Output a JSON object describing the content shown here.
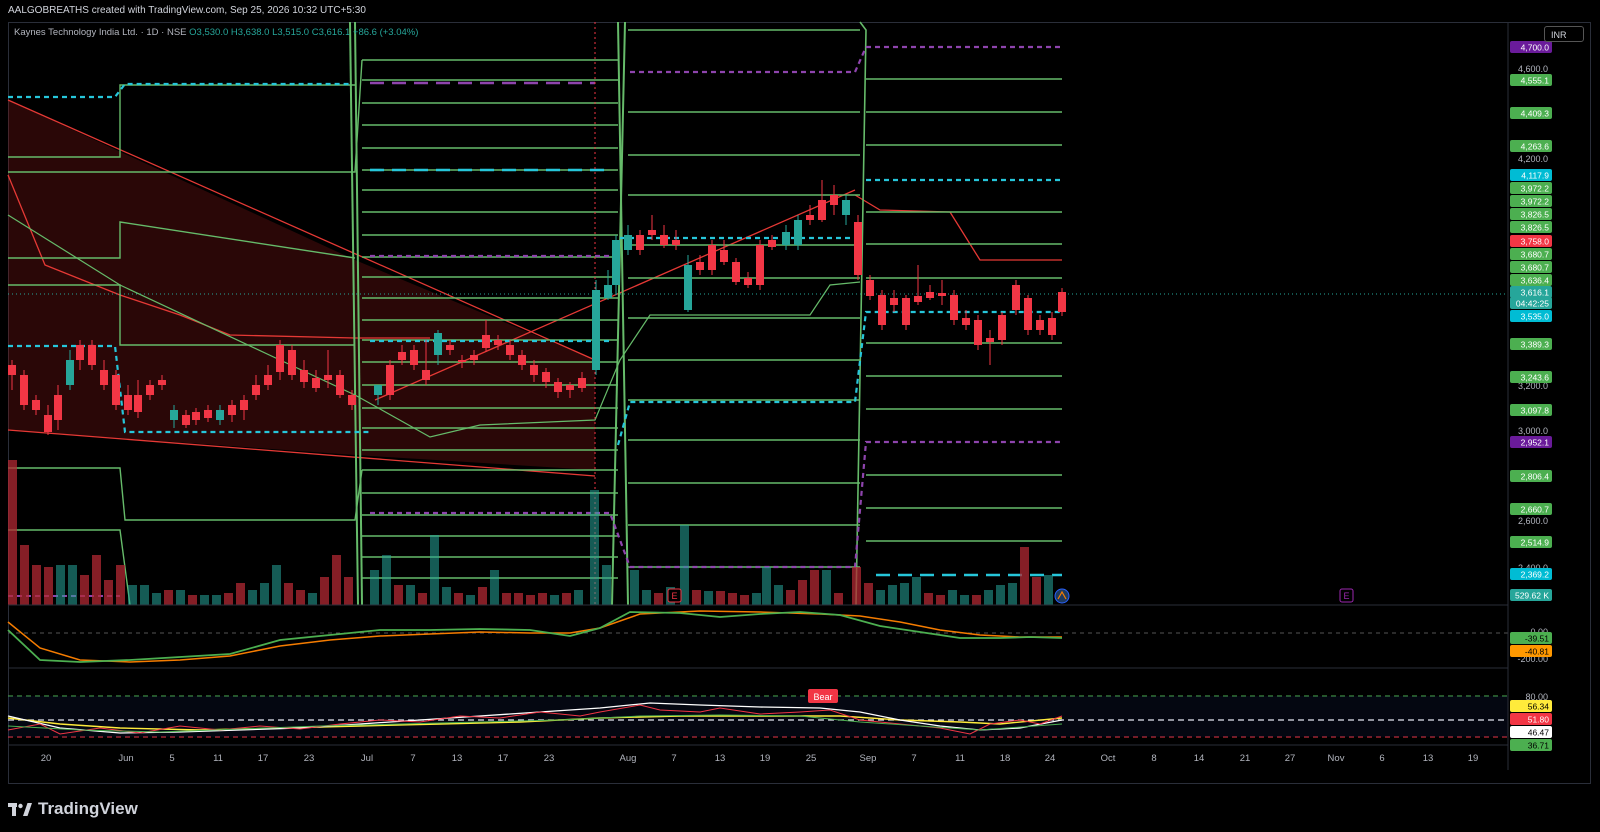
{
  "header": {
    "author_line": "AALGOBREATHS created with TradingView.com, Sep 25, 2026 10:32 UTC+5:30"
  },
  "symbol": {
    "name": "Kaynes Technology India Ltd. · 1D · NSE",
    "open": "O3,530.0",
    "high": "H3,638.0",
    "low": "L3,515.0",
    "close": "C3,616.1",
    "change": "+86.6 (+3.04%)"
  },
  "currency": "INR",
  "price_scale": {
    "ticks": [
      "4,600.0",
      "4,200.0",
      "3,200.0",
      "3,000.0",
      "2,600.0",
      "2,400.0"
    ],
    "labels": [
      {
        "text": "4,700.0",
        "color": "#6a1b9a"
      },
      {
        "text": "4,555.1",
        "color": "#4caf50"
      },
      {
        "text": "4,409.3",
        "color": "#4caf50"
      },
      {
        "text": "4,263.6",
        "color": "#4caf50"
      },
      {
        "text": "4,117.9",
        "color": "#00bcd4"
      },
      {
        "text": "3,972.2",
        "color": "#4caf50"
      },
      {
        "text": "3,972.2",
        "color": "#4caf50"
      },
      {
        "text": "3,826.5",
        "color": "#4caf50"
      },
      {
        "text": "3,826.5",
        "color": "#4caf50"
      },
      {
        "text": "3,758.0",
        "color": "#f23645"
      },
      {
        "text": "3,680.7",
        "color": "#4caf50"
      },
      {
        "text": "3,680.7",
        "color": "#4caf50"
      },
      {
        "text": "3,636.4",
        "color": "#4caf50"
      },
      {
        "text": "3,616.1",
        "color": "#26a69a"
      },
      {
        "text": "04:42:25",
        "color": "#26a69a"
      },
      {
        "text": "3,535.0",
        "color": "#00bcd4"
      },
      {
        "text": "3,389.3",
        "color": "#4caf50"
      },
      {
        "text": "3,243.6",
        "color": "#4caf50"
      },
      {
        "text": "3,097.8",
        "color": "#4caf50"
      },
      {
        "text": "2,952.1",
        "color": "#6a1b9a"
      },
      {
        "text": "2,806.4",
        "color": "#4caf50"
      },
      {
        "text": "2,660.7",
        "color": "#4caf50"
      },
      {
        "text": "2,514.9",
        "color": "#4caf50"
      },
      {
        "text": "2,369.2",
        "color": "#00bcd4"
      },
      {
        "text": "529.62 K",
        "color": "#26a69a"
      }
    ]
  },
  "macd_scale": {
    "ticks": [
      "0.00",
      "-200.00"
    ],
    "labels": [
      {
        "text": "-39.51",
        "color": "#4caf50"
      },
      {
        "text": "-40.81",
        "color": "#ff9800"
      }
    ]
  },
  "rsi_scale": {
    "ticks": [
      "80.00"
    ],
    "labels": [
      {
        "text": "56.34",
        "color": "#ffeb3b",
        "fg": "#000"
      },
      {
        "text": "51.80",
        "color": "#f23645",
        "fg": "#fff"
      },
      {
        "text": "46.47",
        "color": "#ffffff",
        "fg": "#000"
      },
      {
        "text": "36.71",
        "color": "#4caf50",
        "fg": "#000"
      }
    ],
    "bear_label": "Bear"
  },
  "time_axis": [
    "20",
    "Jun",
    "5",
    "11",
    "17",
    "23",
    "Jul",
    "7",
    "13",
    "17",
    "23",
    "Aug",
    "7",
    "13",
    "19",
    "25",
    "Sep",
    "7",
    "11",
    "18",
    "24",
    "Oct",
    "8",
    "14",
    "21",
    "27",
    "Nov",
    "6",
    "13",
    "19"
  ],
  "events": [
    "E",
    "E"
  ],
  "footer": {
    "brand": "TradingView"
  }
}
